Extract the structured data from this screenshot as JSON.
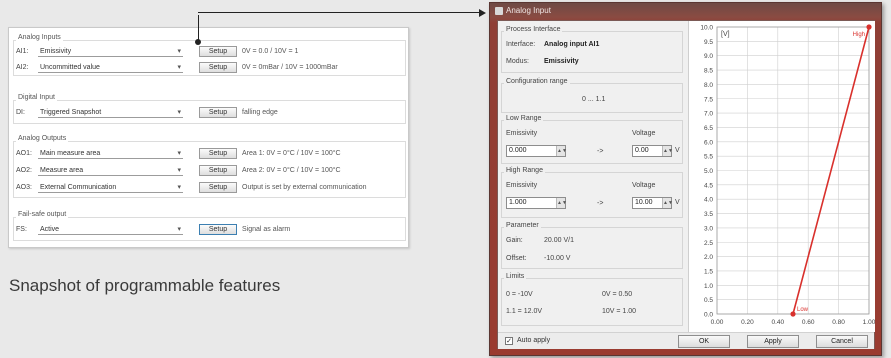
{
  "left_panel": {
    "setup_label": "Setup",
    "groups": [
      {
        "title": "Analog Inputs",
        "rows": [
          {
            "channel": "AI1:",
            "value": "Emissivity",
            "desc": "0V = 0.0 / 10V = 1"
          },
          {
            "channel": "AI2:",
            "value": "Uncommitted value",
            "desc": "0V = 0mBar / 10V = 1000mBar"
          }
        ]
      },
      {
        "title": "Digital Input",
        "rows": [
          {
            "channel": "DI:",
            "value": "Triggered Snapshot",
            "desc": "falling edge"
          }
        ]
      },
      {
        "title": "Analog Outputs",
        "rows": [
          {
            "channel": "AO1:",
            "value": "Main measure area",
            "desc": "Area 1: 0V = 0°C / 10V = 100°C"
          },
          {
            "channel": "AO2:",
            "value": "Measure area",
            "desc": "Area 2: 0V = 0°C / 10V = 100°C"
          },
          {
            "channel": "AO3:",
            "value": "External Communication",
            "desc": "Output is set by external communication"
          }
        ]
      },
      {
        "title": "Fail-safe output",
        "rows": [
          {
            "channel": "FS:",
            "value": "Active",
            "desc": "Signal as alarm"
          }
        ]
      }
    ]
  },
  "caption": "Snapshot of programmable features",
  "dialog": {
    "title": "Analog Input",
    "process_interface": {
      "title": "Process Interface",
      "interface_label": "Interface:",
      "interface_value": "Analog input AI1",
      "modus_label": "Modus:",
      "modus_value": "Emissivity"
    },
    "configuration": {
      "title": "Configuration range",
      "value": "0 ... 1.1"
    },
    "low_range": {
      "title": "Low Range",
      "left_label": "Emissivity",
      "right_label": "Voltage",
      "left_value": "0.000",
      "right_value": "0.00",
      "arrow": "->",
      "unit": "V"
    },
    "high_range": {
      "title": "High Range",
      "left_label": "Emissivity",
      "right_label": "Voltage",
      "left_value": "1.000",
      "right_value": "10.00",
      "arrow": "->",
      "unit": "V"
    },
    "parameter": {
      "title": "Parameter",
      "gain_label": "Gain:",
      "gain_value": "20.00 V/1",
      "offset_label": "Offset:",
      "offset_value": "-10.00 V"
    },
    "limits": {
      "title": "Limits",
      "l1": "0 = -10V",
      "l2": "0V = 0.50",
      "l3": "1.1 = 12.0V",
      "l4": "10V = 1.00"
    },
    "auto_apply": {
      "label": "Auto apply",
      "checked": true,
      "mark": "✓"
    },
    "buttons": {
      "ok": "OK",
      "apply": "Apply",
      "cancel": "Cancel"
    }
  },
  "chart_data": {
    "type": "line",
    "title": "",
    "unit_label": "[V]",
    "xlabel": "",
    "ylabel": "",
    "xlim": [
      0,
      1
    ],
    "ylim": [
      0,
      10
    ],
    "x_ticks": [
      "0.00",
      "0.20",
      "0.40",
      "0.60",
      "0.80",
      "1.00"
    ],
    "y_ticks": [
      "10.0",
      "9.5",
      "9.0",
      "8.5",
      "8.0",
      "7.5",
      "7.0",
      "6.5",
      "6.0",
      "5.5",
      "5.0",
      "4.5",
      "4.0",
      "3.5",
      "3.0",
      "2.5",
      "2.0",
      "1.5",
      "1.0",
      "0.5",
      "0.0"
    ],
    "series": [
      {
        "values": [
          {
            "x": 0.5,
            "y": 0
          },
          {
            "x": 1.0,
            "y": 10
          }
        ]
      }
    ],
    "annotations": [
      {
        "label": "Low",
        "x": 0.5,
        "y": 0
      },
      {
        "label": "High",
        "x": 1.0,
        "y": 10
      }
    ],
    "colors": {
      "line": "#d9302c",
      "grid": "#cfcfcf"
    },
    "grid": true
  }
}
